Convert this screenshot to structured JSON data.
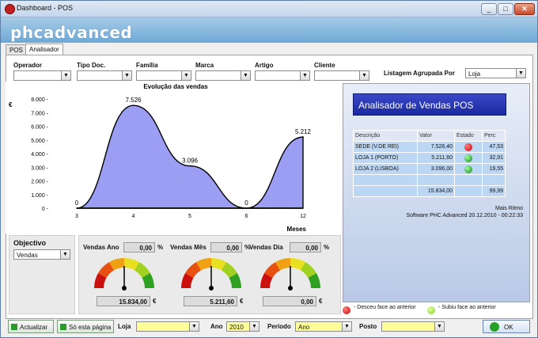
{
  "window": {
    "title": "Dashboard - POS"
  },
  "banner": {
    "logo": "phcadvanced"
  },
  "tabs": [
    {
      "label": "POS"
    },
    {
      "label": "Analisador"
    }
  ],
  "filters": {
    "operador": {
      "label": "Operador",
      "value": ""
    },
    "tipo_doc": {
      "label": "Tipo Doc.",
      "value": ""
    },
    "familia": {
      "label": "Família",
      "value": ""
    },
    "marca": {
      "label": "Marca",
      "value": ""
    },
    "artigo": {
      "label": "Artigo",
      "value": ""
    },
    "cliente": {
      "label": "Cliente",
      "value": ""
    },
    "listagem": {
      "label": "Listagem Agrupada Por",
      "value": "Loja"
    }
  },
  "chart_data": {
    "type": "area",
    "title": "Evolução das vendas",
    "xlabel": "Meses",
    "ylabel": "€",
    "x": [
      3,
      4,
      5,
      6,
      12
    ],
    "y": [
      0,
      7526,
      3096,
      0,
      5212
    ],
    "point_labels": [
      "0",
      "7.526",
      "3.096",
      "0",
      "5.212"
    ],
    "yticks": [
      "0",
      "1.000",
      "2.000",
      "3.000",
      "4.000",
      "5.000",
      "6.000",
      "7.000",
      "8.000"
    ],
    "ylim": [
      0,
      8000
    ],
    "fill_color": "#9b9ef2"
  },
  "analyzer": {
    "title": "Analisador de Vendas POS",
    "columns": [
      "Descrição",
      "Valor",
      "Estado",
      "Perc"
    ],
    "rows": [
      {
        "descricao": "SEDE (V.DE REI)",
        "valor": "7.526,40",
        "estado": "red",
        "perc": "47,53"
      },
      {
        "descricao": "LOJA 1 (PORTO)",
        "valor": "5.211,60",
        "estado": "green",
        "perc": "32,91"
      },
      {
        "descricao": "LOJA 2 (LISBOA)",
        "valor": "3.096,00",
        "estado": "green",
        "perc": "19,55"
      }
    ],
    "total_valor": "15.834,00",
    "total_perc": "99,99",
    "footer1": "Mais Ritmo",
    "footer2": "Software PHC Advanced 20.12.2010 - 00:22:33"
  },
  "legend": {
    "down": "- Desceu face ao anterior",
    "up": "- Subiu face ao anterior"
  },
  "objective": {
    "label": "Objectivo",
    "value": "Vendas"
  },
  "gauges": [
    {
      "label": "Vendas Ano",
      "pct": "0,00",
      "unit": "%",
      "value": "15.834,00",
      "currency": "€"
    },
    {
      "label": "Vendas Mês",
      "pct": "0,00",
      "unit": "%",
      "value": "5.211,60",
      "currency": "€"
    },
    {
      "label": "Vendas Dia",
      "pct": "0,00",
      "unit": "%",
      "value": "0,00",
      "currency": "€"
    }
  ],
  "toolbar": {
    "refresh": "Actualizar",
    "this_page": "Só esta página",
    "loja_label": "Loja",
    "loja_value": "",
    "ano_label": "Ano",
    "ano_value": "2010",
    "periodo_label": "Período",
    "periodo_value": "Ano",
    "posto_label": "Posto",
    "posto_value": "",
    "ok": "OK"
  }
}
